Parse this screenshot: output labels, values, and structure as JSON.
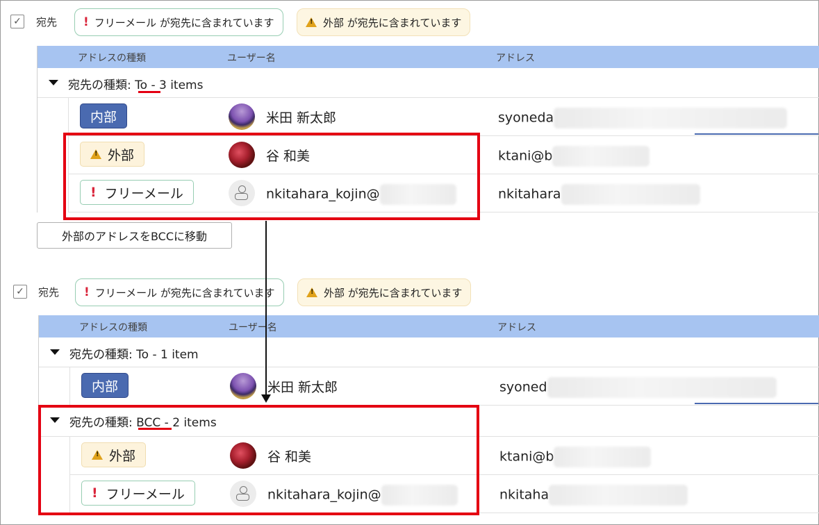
{
  "sections": [
    {
      "check_label": "宛先",
      "chips": [
        {
          "type": "freemail",
          "text": "フリーメール が宛先に含まれています"
        },
        {
          "type": "external",
          "text": "外部 が宛先に含まれています"
        }
      ],
      "headers": [
        "アドレスの種類",
        "ユーザー名",
        "アドレス"
      ],
      "groups": [
        {
          "prefix": "宛先の種類: ",
          "kind": "To",
          "suffix": " - 3 items",
          "rows": [
            {
              "badge": "内部",
              "badge_type": "internal",
              "avatar": "photo",
              "name": "米田 新太郎",
              "address": "syoneda"
            },
            {
              "badge": "外部",
              "badge_type": "external",
              "avatar": "photo",
              "name": "谷 和美",
              "address": "ktani@b"
            },
            {
              "badge": "フリーメール",
              "badge_type": "freemail",
              "avatar": "default",
              "name": "nkitahara_kojin@",
              "address": "nkitahara"
            }
          ]
        }
      ]
    },
    {
      "check_label": "宛先",
      "chips": [
        {
          "type": "freemail",
          "text": "フリーメール が宛先に含まれています"
        },
        {
          "type": "external",
          "text": "外部 が宛先に含まれています"
        }
      ],
      "headers": [
        "アドレスの種類",
        "ユーザー名",
        "アドレス"
      ],
      "groups": [
        {
          "prefix": "宛先の種類: ",
          "kind": "To",
          "suffix": " - 1 item",
          "rows": [
            {
              "badge": "内部",
              "badge_type": "internal",
              "avatar": "photo",
              "name": "米田 新太郎",
              "address": "syoned"
            }
          ]
        },
        {
          "prefix": "宛先の種類: ",
          "kind": "BCC",
          "suffix": " - 2 items",
          "rows": [
            {
              "badge": "外部",
              "badge_type": "external",
              "avatar": "photo",
              "name": "谷 和美",
              "address": "ktani@b"
            },
            {
              "badge": "フリーメール",
              "badge_type": "freemail",
              "avatar": "default",
              "name": "nkitahara_kojin@",
              "address": "nkitaha"
            }
          ]
        }
      ]
    }
  ],
  "move_button": "外部のアドレスをBCCに移動",
  "colors": {
    "header_bg": "#a7c4f1",
    "internal_badge": "#4a6ab0",
    "external_badge": "#fdf3dc",
    "freemail_border": "#97cdb2",
    "highlight_red": "#e40012",
    "warning_icon": "#e0a21b",
    "exclamation": "#d9243a"
  }
}
